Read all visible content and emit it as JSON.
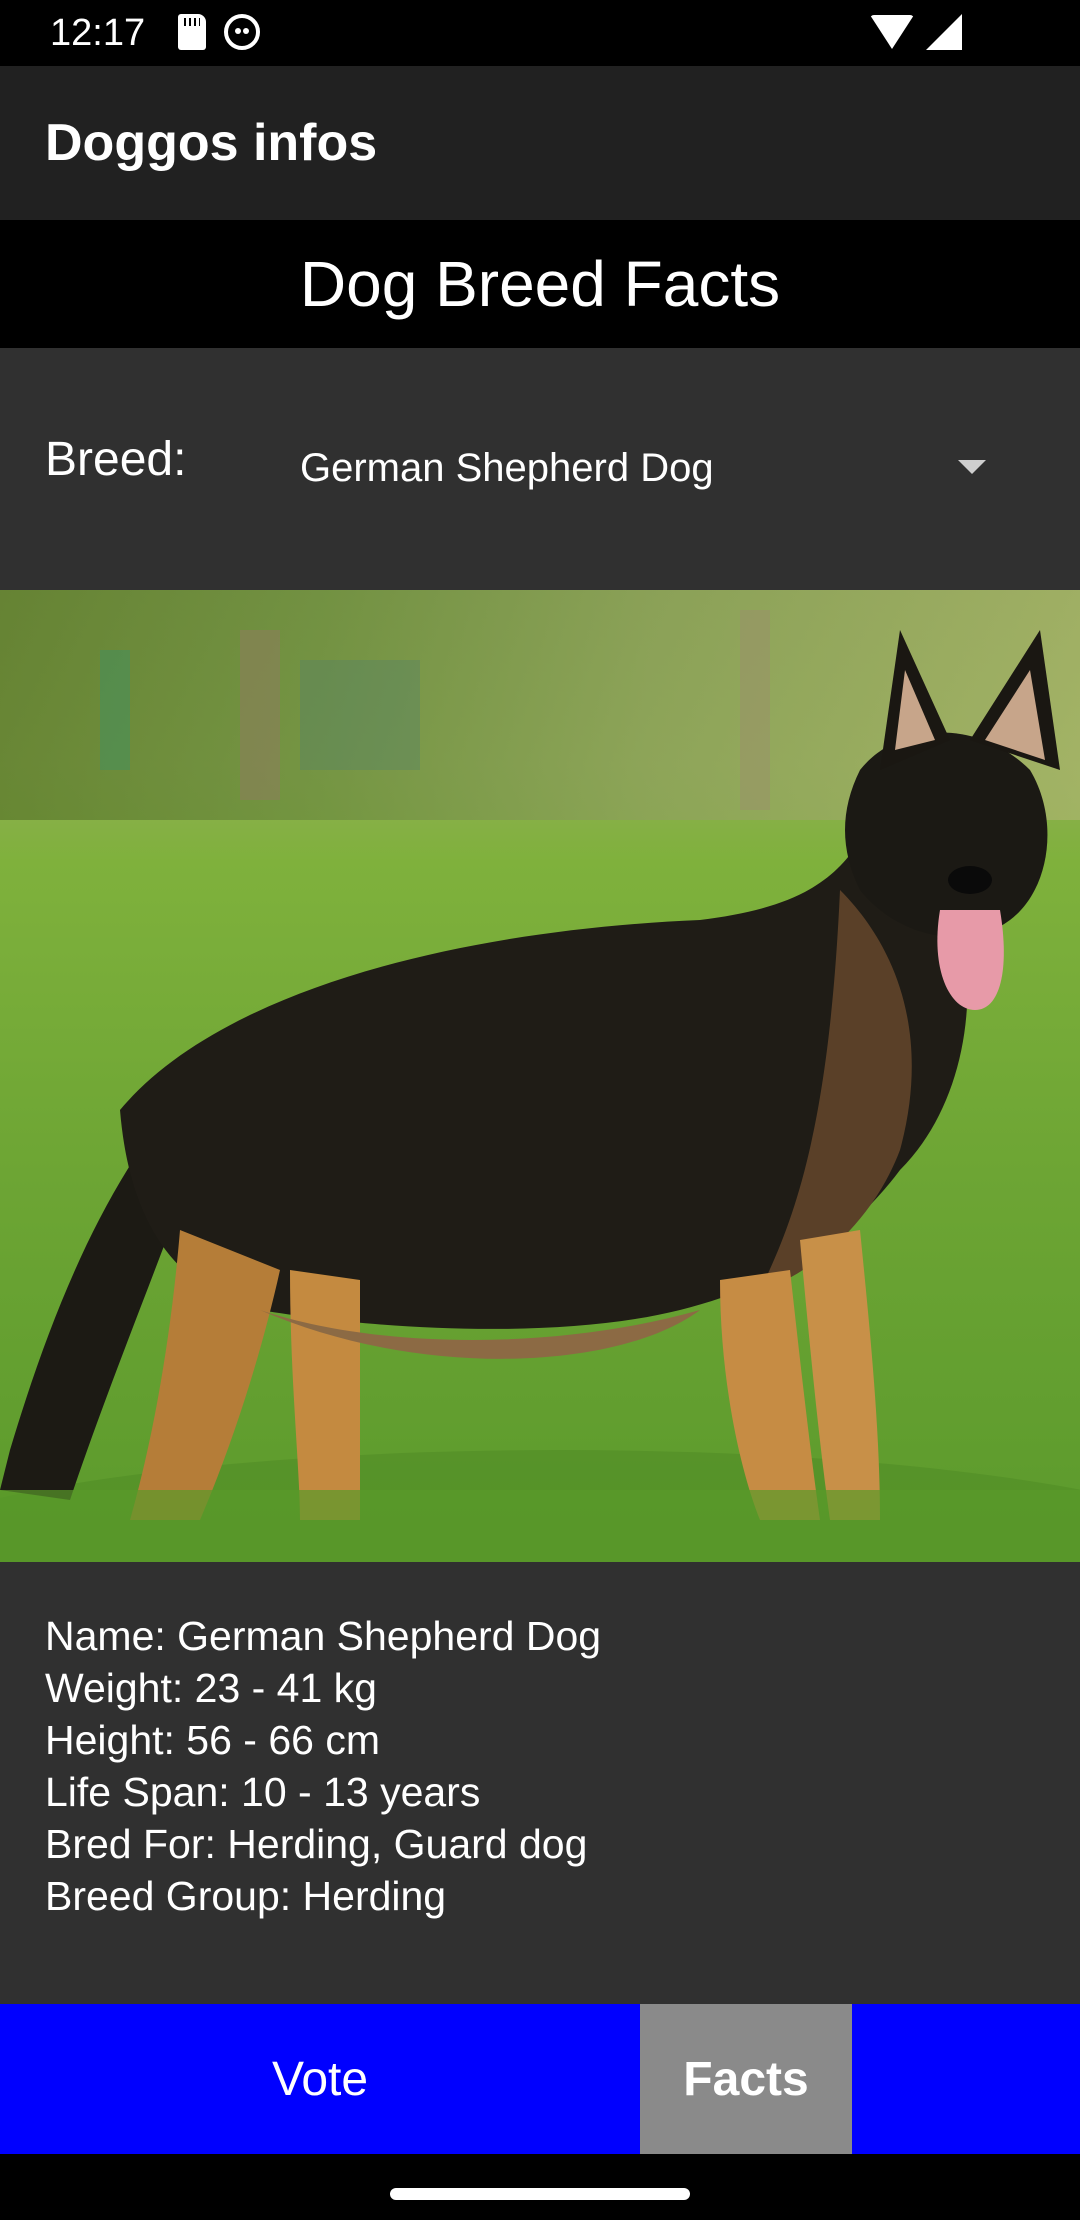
{
  "status_bar": {
    "time": "12:17",
    "icons_left": [
      "sd-card-icon",
      "cat-face-icon"
    ],
    "icons_right": [
      "wifi-icon",
      "cell-signal-icon"
    ]
  },
  "app_bar": {
    "title": "Doggos infos"
  },
  "page": {
    "heading": "Dog Breed Facts"
  },
  "breed_selector": {
    "label": "Breed:",
    "selected_value": "German Shepherd Dog"
  },
  "facts": {
    "lines": [
      "Name: German Shepherd Dog",
      "Weight: 23 - 41 kg",
      "Height: 56 - 66 cm",
      "Life Span: 10 - 13 years",
      "Bred For: Herding, Guard dog",
      "Breed Group: Herding"
    ]
  },
  "bottom_nav": {
    "tabs": [
      {
        "label": "Vote",
        "active": false
      },
      {
        "label": "Facts",
        "active": true
      }
    ]
  },
  "colors": {
    "nav_background": "#0000ff",
    "nav_active": "#8a8a8a",
    "app_bar": "#212121",
    "body": "#303030"
  }
}
